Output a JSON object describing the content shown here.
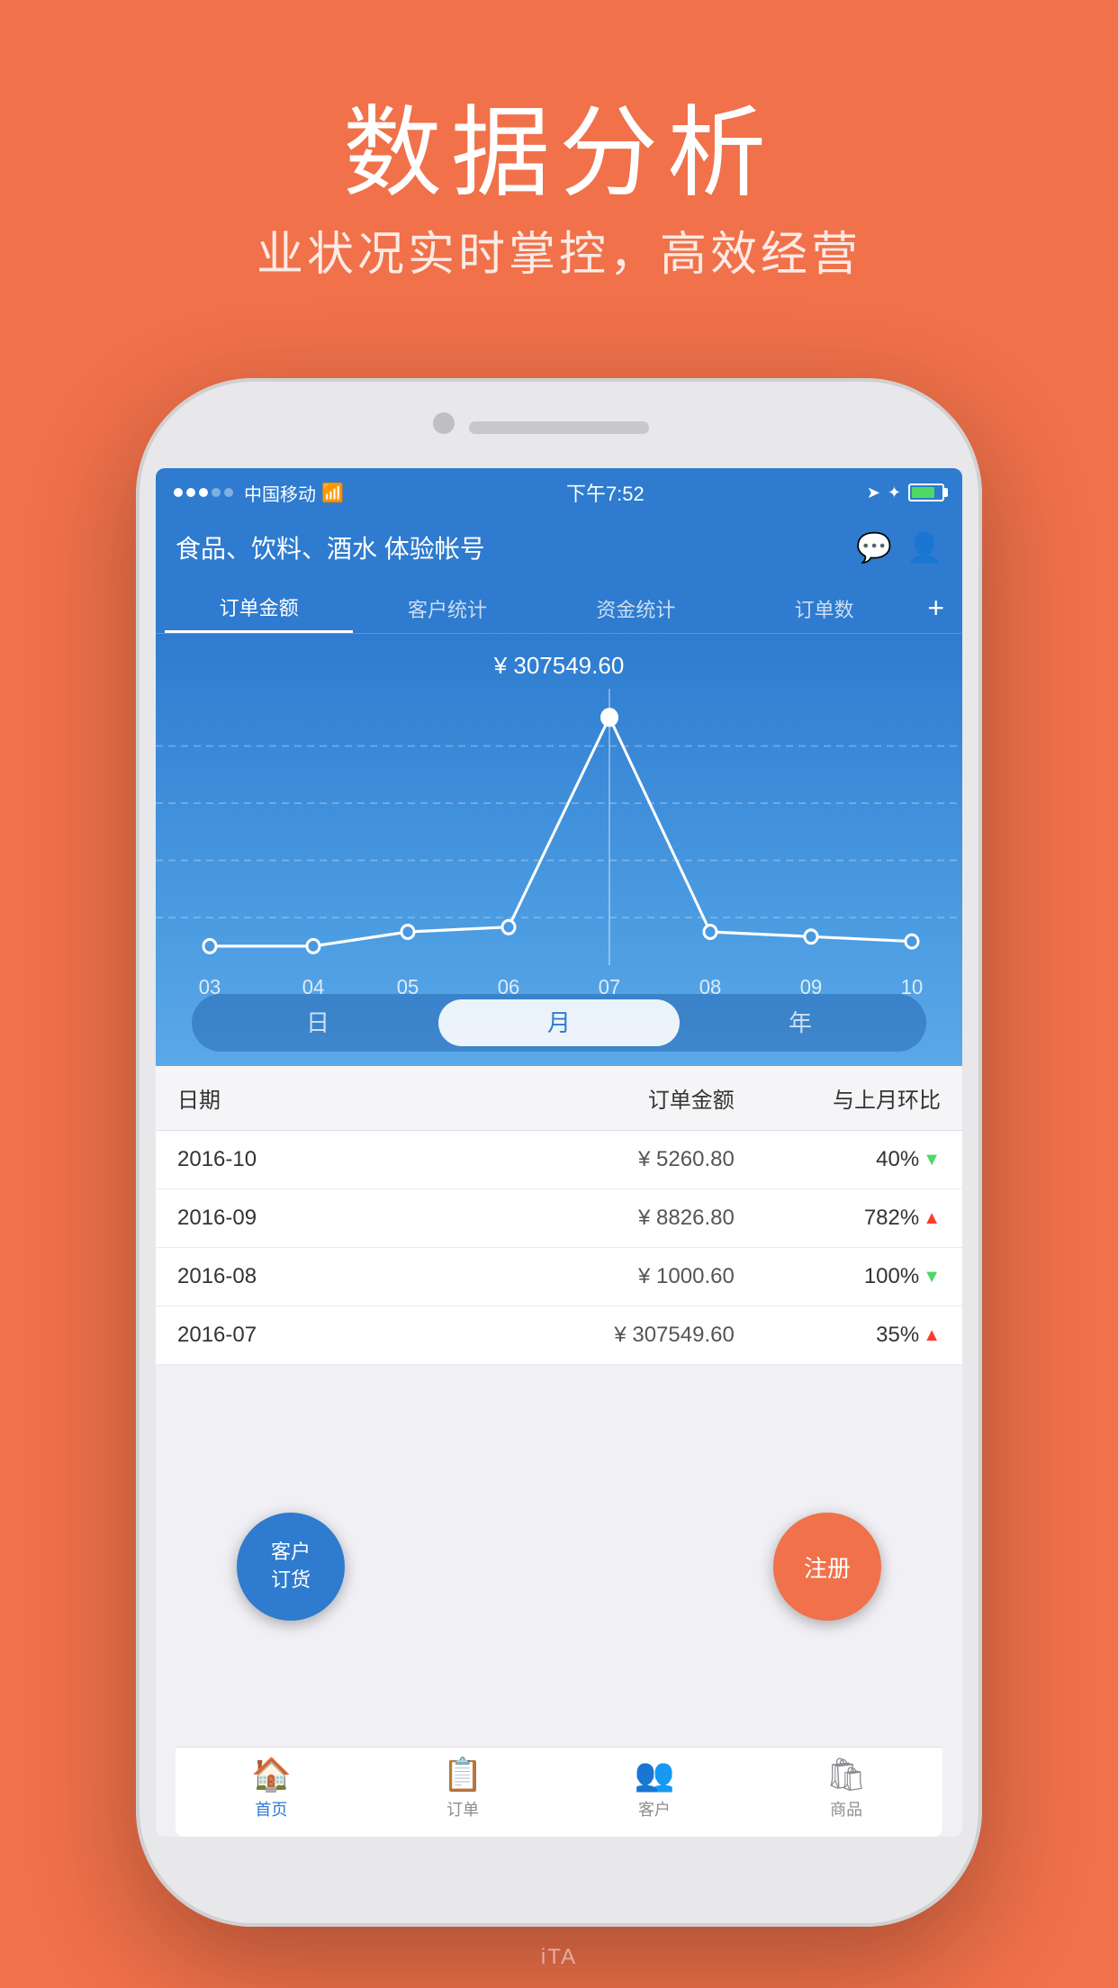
{
  "hero": {
    "title": "数据分析",
    "subtitle": "业状况实时掌控，高效经营"
  },
  "status_bar": {
    "carrier": "中国移动",
    "time": "下午7:52",
    "signal_dots": [
      true,
      true,
      true,
      false,
      false
    ]
  },
  "app_header": {
    "title": "食品、饮料、酒水 体验帐号",
    "message_icon": "💬",
    "user_icon": "👤"
  },
  "tabs": [
    {
      "label": "订单金额",
      "active": true
    },
    {
      "label": "客户统计",
      "active": false
    },
    {
      "label": "资金统计",
      "active": false
    },
    {
      "label": "订单数",
      "active": false
    }
  ],
  "chart": {
    "value": "¥ 307549.60",
    "x_labels": [
      "03",
      "04",
      "05",
      "06",
      "07",
      "08",
      "09",
      "10"
    ],
    "time_options": [
      "日",
      "月",
      "年"
    ],
    "active_time": "月"
  },
  "table": {
    "headers": [
      "日期",
      "订单金额",
      "与上月环比"
    ],
    "rows": [
      {
        "date": "2016-10",
        "amount": "¥ 5260.80",
        "change": "40%",
        "trend": "down"
      },
      {
        "date": "2016-09",
        "amount": "¥ 8826.80",
        "change": "782%",
        "trend": "up"
      },
      {
        "date": "2016-08",
        "amount": "¥ 1000.60",
        "change": "100%",
        "trend": "down"
      },
      {
        "date": "2016-07",
        "amount": "¥ 307549.60",
        "change": "35%",
        "trend": "up"
      }
    ]
  },
  "bottom_nav": [
    {
      "label": "首页",
      "active": true
    },
    {
      "label": "订单",
      "active": false
    },
    {
      "label": "客户",
      "active": false
    },
    {
      "label": "商品",
      "active": false
    }
  ],
  "fabs": {
    "customer": "客户\n订货",
    "register": "注册"
  },
  "watermark": "iTA"
}
